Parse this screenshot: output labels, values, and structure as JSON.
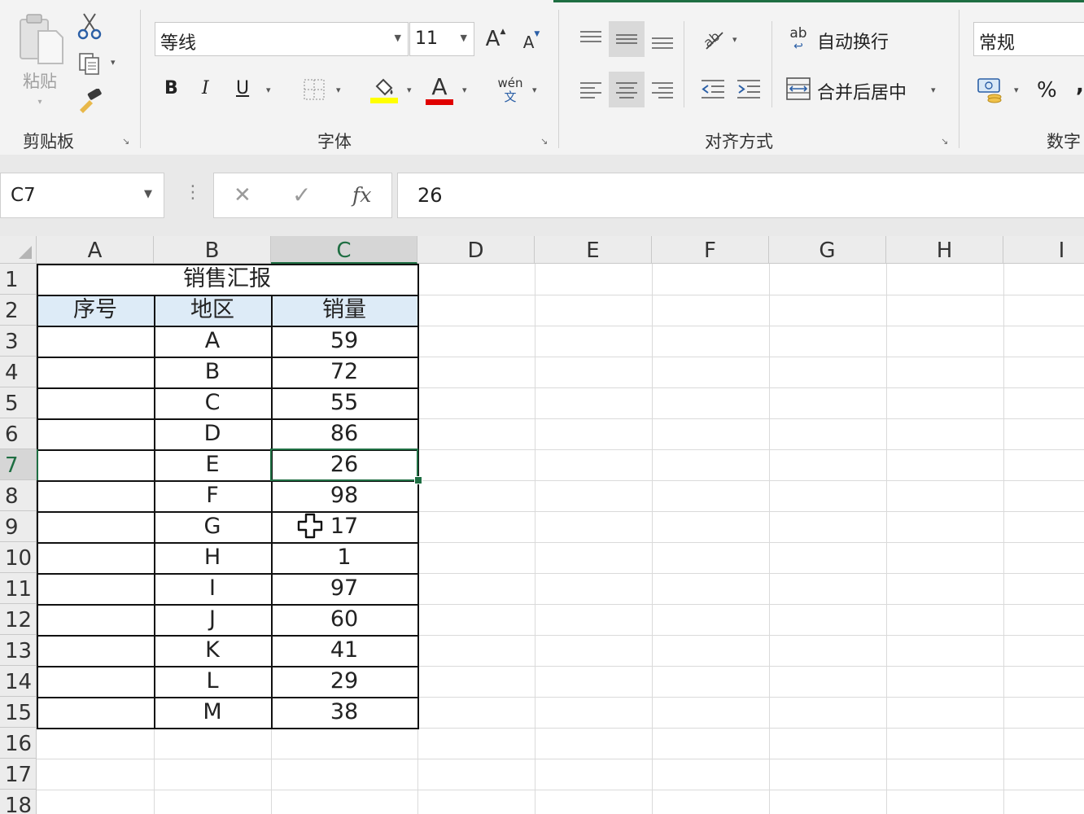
{
  "ribbon": {
    "clipboard": {
      "paste_label": "粘贴",
      "group_label": "剪贴板"
    },
    "font": {
      "font_name": "等线",
      "font_size": "11",
      "grow_label": "A",
      "shrink_label": "A",
      "bold_label": "B",
      "italic_label": "I",
      "underline_label": "U",
      "phonetic_top": "wén",
      "phonetic_bottom": "文",
      "group_label": "字体",
      "highlight_color": "#ffff00",
      "font_color": "#e00000"
    },
    "alignment": {
      "wrap_icon_text": "ab",
      "wrap_label": "自动换行",
      "merge_label": "合并后居中",
      "group_label": "对齐方式"
    },
    "number": {
      "format_value": "常规",
      "percent_label": "%",
      "group_label": "数字"
    }
  },
  "formula_bar": {
    "name_box": "C7",
    "cancel_glyph": "✕",
    "enter_glyph": "✓",
    "fx_label": "fx",
    "content": "26"
  },
  "grid": {
    "columns": [
      "A",
      "B",
      "C",
      "D",
      "E",
      "F",
      "G",
      "H",
      "I"
    ],
    "rows": [
      "1",
      "2",
      "3",
      "4",
      "5",
      "6",
      "7",
      "8",
      "9",
      "10",
      "11",
      "12",
      "13",
      "14",
      "15",
      "16",
      "17",
      "18"
    ],
    "title": "销售汇报",
    "headers": [
      "序号",
      "地区",
      "销量"
    ],
    "data": [
      [
        "",
        "A",
        "59"
      ],
      [
        "",
        "B",
        "72"
      ],
      [
        "",
        "C",
        "55"
      ],
      [
        "",
        "D",
        "86"
      ],
      [
        "",
        "E",
        "26"
      ],
      [
        "",
        "F",
        "98"
      ],
      [
        "",
        "G",
        "17"
      ],
      [
        "",
        "H",
        "1"
      ],
      [
        "",
        "I",
        "97"
      ],
      [
        "",
        "J",
        "60"
      ],
      [
        "",
        "K",
        "41"
      ],
      [
        "",
        "L",
        "29"
      ],
      [
        "",
        "M",
        "38"
      ]
    ],
    "header_fill": "#ddebf7",
    "selection_color": "#1e6e42"
  }
}
